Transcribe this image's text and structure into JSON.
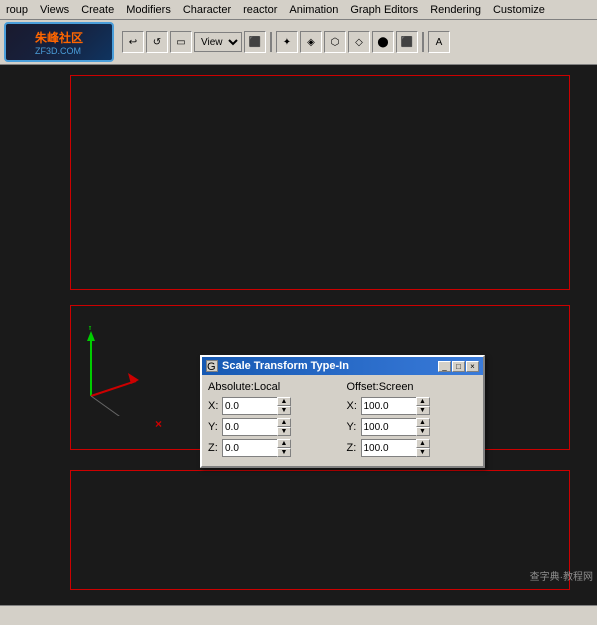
{
  "menubar": {
    "items": [
      "roup",
      "Views",
      "Create",
      "Modifiers",
      "Character",
      "reactor",
      "Animation",
      "Graph Editors",
      "Rendering",
      "Customize"
    ]
  },
  "toolbar": {
    "view_label": "View"
  },
  "logo": {
    "line1": "朱峰社区",
    "line2": "ZF3D.COM"
  },
  "dialog": {
    "title": "Scale Transform Type-In",
    "minimize_label": "_",
    "restore_label": "□",
    "close_label": "×",
    "section_absolute": "Absolute:Local",
    "section_offset": "Offset:Screen",
    "x_label": "X:",
    "y_label": "Y:",
    "z_label": "Z:",
    "abs_x_value": "0.0",
    "abs_y_value": "0.0",
    "abs_z_value": "0.0",
    "off_x_value": "100.0",
    "off_y_value": "100.0",
    "off_z_value": "100.0"
  },
  "statusbar": {
    "text": ""
  },
  "watermark": {
    "text": "查字典·教程网"
  }
}
